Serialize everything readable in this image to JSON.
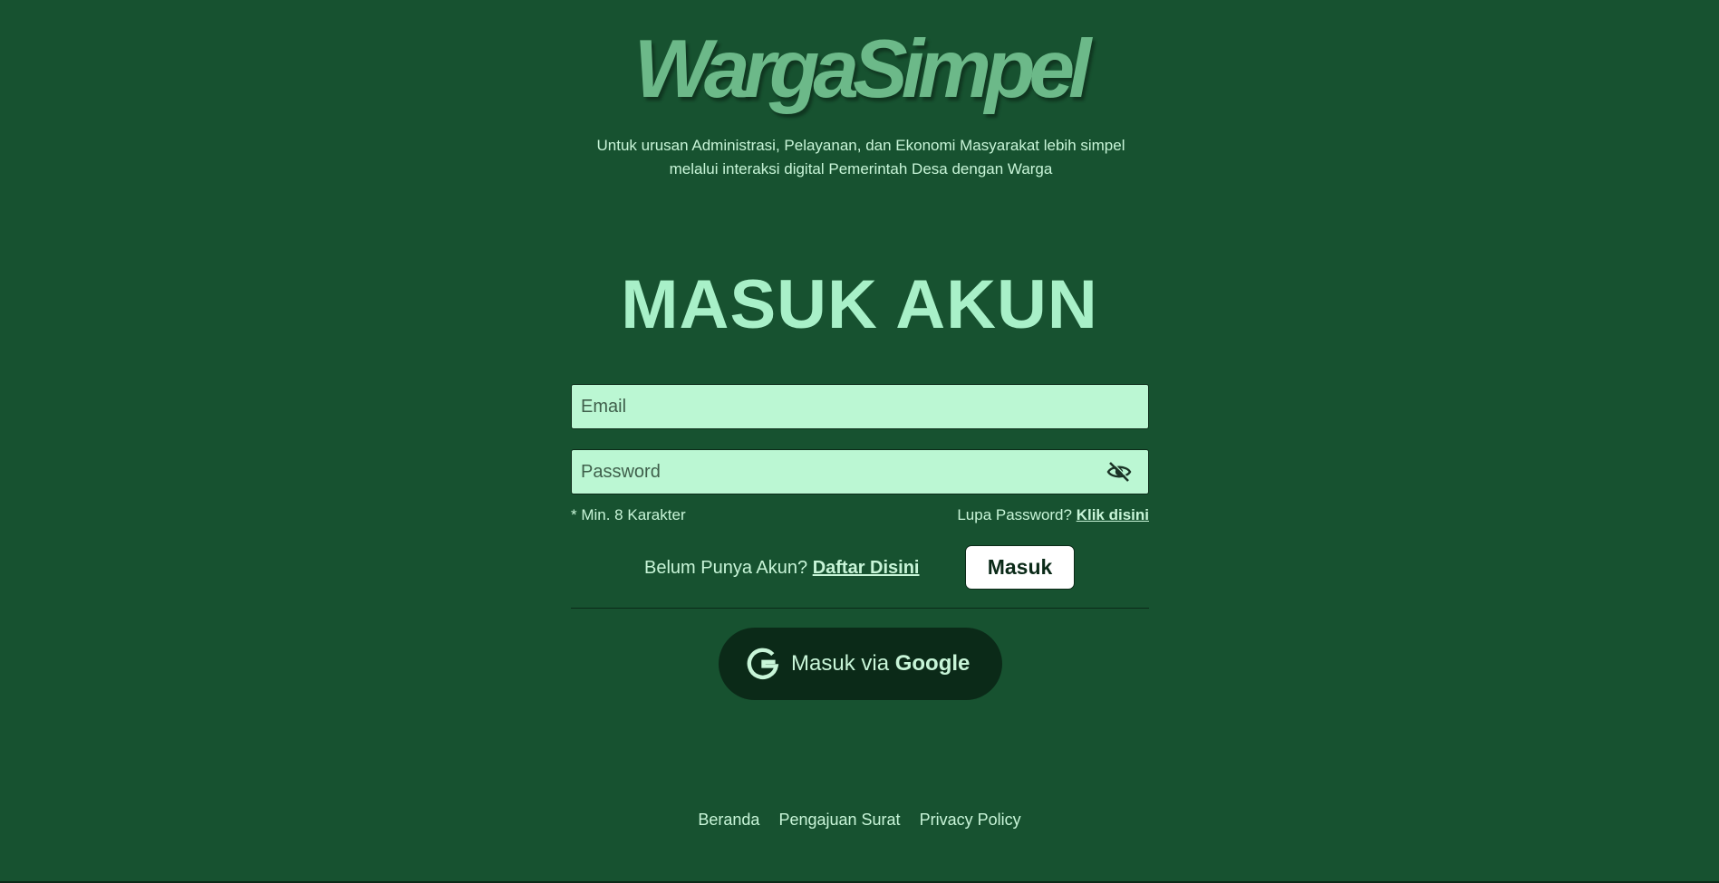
{
  "brand": {
    "logo_text": "WargaSimpel",
    "tagline_line1": "Untuk urusan Administrasi, Pelayanan, dan Ekonomi Masyarakat lebih simpel",
    "tagline_line2": "melalui interaksi digital Pemerintah Desa dengan Warga"
  },
  "login": {
    "heading": "MASUK AKUN",
    "email_placeholder": "Email",
    "email_value": "",
    "password_placeholder": "Password",
    "password_value": "",
    "password_hint": "* Min. 8 Karakter",
    "forgot_prefix": "Lupa Password?",
    "forgot_link": "Klik disini",
    "register_prefix": "Belum Punya Akun?",
    "register_link": "Daftar Disini",
    "submit_label": "Masuk",
    "google_prefix": "Masuk via",
    "google_brand": "Google",
    "toggle_icon": "eye-slash-icon",
    "google_icon": "google-g-icon"
  },
  "footer": {
    "links": [
      "Beranda",
      "Pengajuan Surat",
      "Privacy Policy"
    ]
  },
  "colors": {
    "background": "#175230",
    "logo": "#6cb989",
    "heading": "#a8f0c8",
    "text": "#c8f5d8",
    "input_background": "#bbf7d3",
    "dark": "#0b2a18",
    "button_background": "#ffffff"
  }
}
